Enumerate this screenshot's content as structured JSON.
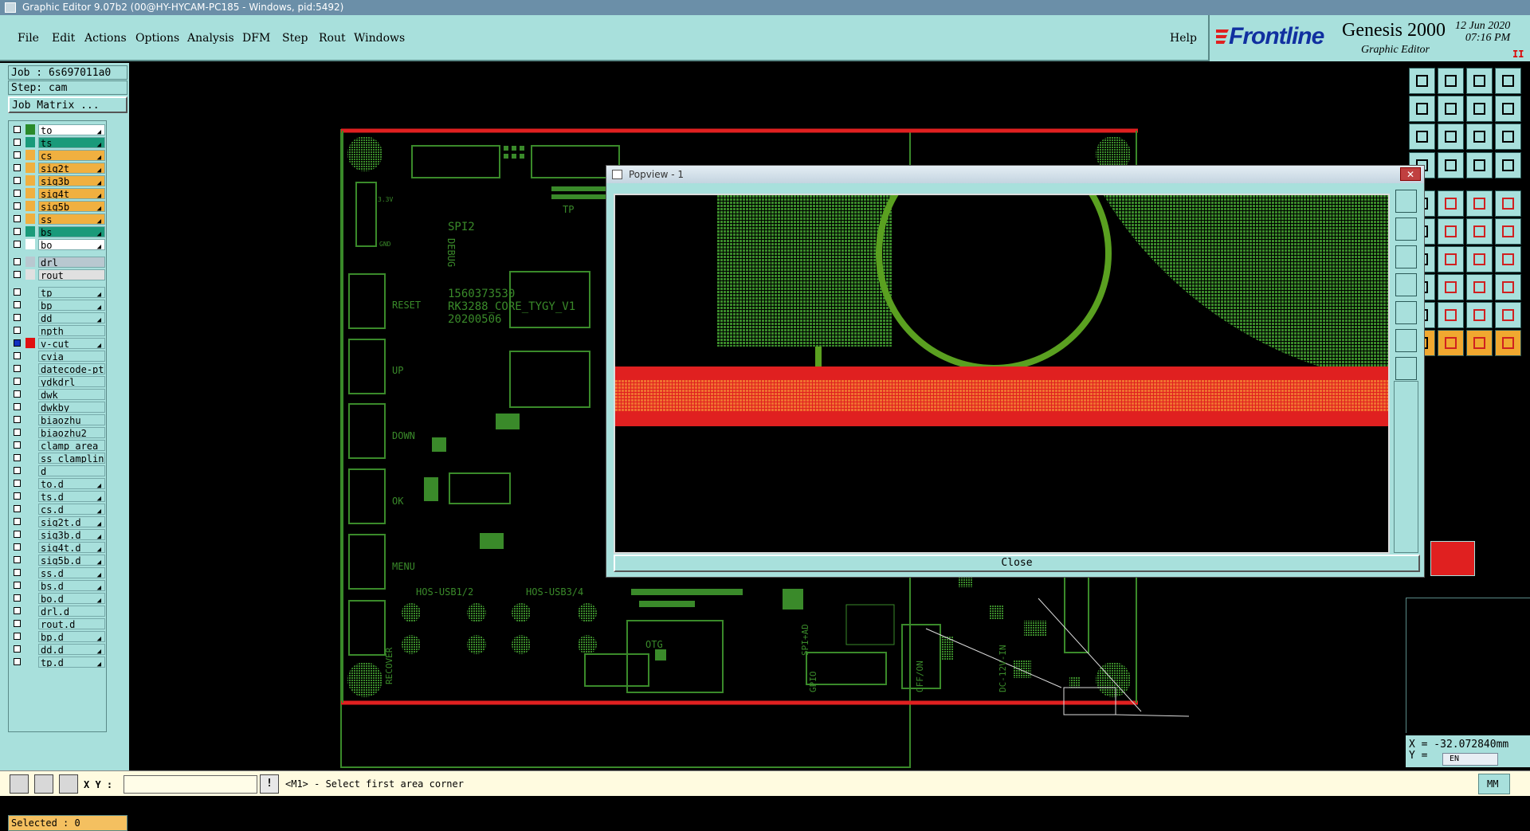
{
  "window": {
    "title": "Graphic Editor 9.07b2 (00@HY-HYCAM-PC185 - Windows, pid:5492)"
  },
  "menu": {
    "file": "File",
    "edit": "Edit",
    "actions": "Actions",
    "options": "Options",
    "analysis": "Analysis",
    "dfm": "DFM",
    "step": "Step",
    "rout": "Rout",
    "windows": "Windows",
    "help": "Help"
  },
  "brand": {
    "logo_prefix": "Front",
    "logo_suffix": "line",
    "product": "Genesis 2000",
    "subtitle": "Graphic Editor",
    "date": "12 Jun 2020",
    "time": "07:16 PM",
    "pause": "II"
  },
  "job": {
    "job_label": "Job : 6s697011a0",
    "step_label": "Step: cam",
    "matrix_button": "Job Matrix ..."
  },
  "layers": [
    {
      "name": "to",
      "color": "#2a8a2a",
      "bg": "#ffffff",
      "arrow": true
    },
    {
      "name": "ts",
      "color": "#1a9a7a",
      "bg": "#1a9a7a",
      "arrow": true
    },
    {
      "name": "cs",
      "color": "#f0b040",
      "bg": "#f0b040",
      "arrow": true
    },
    {
      "name": "sig2t",
      "color": "#f0b040",
      "bg": "#f0b040",
      "arrow": true
    },
    {
      "name": "sig3b",
      "color": "#f0b040",
      "bg": "#f0b040",
      "arrow": true
    },
    {
      "name": "sig4t",
      "color": "#f0b040",
      "bg": "#f0b040",
      "arrow": true
    },
    {
      "name": "sig5b",
      "color": "#f0b040",
      "bg": "#f0b040",
      "arrow": true
    },
    {
      "name": "ss",
      "color": "#f0b040",
      "bg": "#f0b040",
      "arrow": true
    },
    {
      "name": "bs",
      "color": "#1a9a7a",
      "bg": "#1a9a7a",
      "arrow": true
    },
    {
      "name": "bo",
      "color": "#ffffff",
      "bg": "#ffffff",
      "arrow": true
    },
    {
      "sep": true
    },
    {
      "name": "drl",
      "color": "#b8c8d0",
      "bg": "#b8c8d0",
      "arrow": false
    },
    {
      "name": "rout",
      "color": "#e0e0e0",
      "bg": "#e0e0e0",
      "arrow": false
    },
    {
      "sep": true
    },
    {
      "name": "tp",
      "color": "#a8e0dc",
      "bg": "#a8e0dc",
      "arrow": true
    },
    {
      "name": "bp",
      "color": "#a8e0dc",
      "bg": "#a8e0dc",
      "arrow": true
    },
    {
      "name": "dd",
      "color": "#a8e0dc",
      "bg": "#a8e0dc",
      "arrow": true
    },
    {
      "name": "npth",
      "color": "#a8e0dc",
      "bg": "#a8e0dc",
      "arrow": false
    },
    {
      "name": "v-cut",
      "color": "#e01010",
      "bg": "#a8e0dc",
      "arrow": true,
      "checked": true
    },
    {
      "name": "cvia",
      "color": "#a8e0dc",
      "bg": "#a8e0dc",
      "arrow": false
    },
    {
      "name": "datecode-pte",
      "color": "#a8e0dc",
      "bg": "#a8e0dc",
      "arrow": false
    },
    {
      "name": "ydkdrl",
      "color": "#a8e0dc",
      "bg": "#a8e0dc",
      "arrow": false
    },
    {
      "name": "dwk",
      "color": "#a8e0dc",
      "bg": "#a8e0dc",
      "arrow": false
    },
    {
      "name": "dwkby",
      "color": "#a8e0dc",
      "bg": "#a8e0dc",
      "arrow": false
    },
    {
      "name": "biaozhu",
      "color": "#a8e0dc",
      "bg": "#a8e0dc",
      "arrow": false
    },
    {
      "name": "biaozhu2",
      "color": "#a8e0dc",
      "bg": "#a8e0dc",
      "arrow": false
    },
    {
      "name": "clamp_area",
      "color": "#a8e0dc",
      "bg": "#a8e0dc",
      "arrow": false
    },
    {
      "name": "ss_clampline",
      "color": "#a8e0dc",
      "bg": "#a8e0dc",
      "arrow": false
    },
    {
      "name": "d",
      "color": "#a8e0dc",
      "bg": "#a8e0dc",
      "arrow": false
    },
    {
      "name": "to.d",
      "color": "#a8e0dc",
      "bg": "#a8e0dc",
      "arrow": true
    },
    {
      "name": "ts.d",
      "color": "#a8e0dc",
      "bg": "#a8e0dc",
      "arrow": true
    },
    {
      "name": "cs.d",
      "color": "#a8e0dc",
      "bg": "#a8e0dc",
      "arrow": true
    },
    {
      "name": "sig2t.d",
      "color": "#a8e0dc",
      "bg": "#a8e0dc",
      "arrow": true
    },
    {
      "name": "sig3b.d",
      "color": "#a8e0dc",
      "bg": "#a8e0dc",
      "arrow": true
    },
    {
      "name": "sig4t.d",
      "color": "#a8e0dc",
      "bg": "#a8e0dc",
      "arrow": true
    },
    {
      "name": "sig5b.d",
      "color": "#a8e0dc",
      "bg": "#a8e0dc",
      "arrow": true
    },
    {
      "name": "ss.d",
      "color": "#a8e0dc",
      "bg": "#a8e0dc",
      "arrow": true
    },
    {
      "name": "bs.d",
      "color": "#a8e0dc",
      "bg": "#a8e0dc",
      "arrow": true
    },
    {
      "name": "bo.d",
      "color": "#a8e0dc",
      "bg": "#a8e0dc",
      "arrow": true
    },
    {
      "name": "drl.d",
      "color": "#a8e0dc",
      "bg": "#a8e0dc",
      "arrow": false
    },
    {
      "name": "rout.d",
      "color": "#a8e0dc",
      "bg": "#a8e0dc",
      "arrow": false
    },
    {
      "name": "bp.d",
      "color": "#a8e0dc",
      "bg": "#a8e0dc",
      "arrow": true
    },
    {
      "name": "dd.d",
      "color": "#a8e0dc",
      "bg": "#a8e0dc",
      "arrow": true
    },
    {
      "name": "tp.d",
      "color": "#a8e0dc",
      "bg": "#a8e0dc",
      "arrow": true
    }
  ],
  "selected": "Selected : 0",
  "status": {
    "xy_label": "X Y :",
    "input_value": "",
    "prompt": "<M1> - Select first area corner",
    "units": "MM",
    "excl": "!"
  },
  "coords": {
    "x": "X = -32.072840mm",
    "y": "Y = ",
    "lang": "EN"
  },
  "popview": {
    "title": "Popview - 1",
    "close": "Close",
    "x": "✕"
  },
  "board_text": {
    "part": "1560373530",
    "name": "RK3288_CORE_TYGY_V1",
    "date": "20200506",
    "spi2": "SPI2",
    "debug": "DEBUG",
    "tp": "TP",
    "reset": "RESET",
    "up": "UP",
    "down": "DOWN",
    "ok": "OK",
    "menu": "MENU",
    "usb12": "HOS-USB1/2",
    "usb34": "HOS-USB3/4",
    "otg": "OTG",
    "recover": "RECOVER",
    "spi_ad": "SPI+AD",
    "gpio": "GPIO",
    "offon": "OFF/ON",
    "dc12": "DC-12V-IN",
    "v33": "3.3V",
    "gnd": "GND"
  },
  "colors": {
    "panel": "#a8e0dc",
    "trace": "#3a8a2a",
    "vcut": "#e02020",
    "accent_orange": "#f0a830"
  }
}
